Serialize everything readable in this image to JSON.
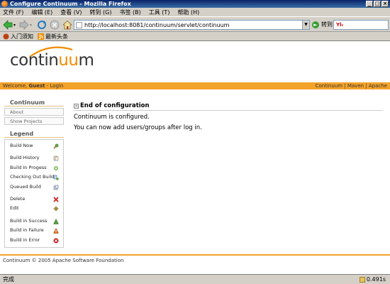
{
  "window": {
    "title": "Configure Continuum - Mozilla Firefox"
  },
  "menu": [
    "文件 (F)",
    "编辑 (E)",
    "查看 (V)",
    "转到 (G)",
    "书签 (B)",
    "工具 (T)",
    "帮助 (H)"
  ],
  "navbar": {
    "url": "http://localhost:8081/continuum/servlet/continuum",
    "go_label": "转到"
  },
  "bookmarks": [
    {
      "label": "入门须知",
      "icon": "firefox-bookmark-icon"
    },
    {
      "label": "最新头条",
      "icon": "rss-feed-icon"
    }
  ],
  "page": {
    "logo": {
      "pre": "contin",
      "accent": "uu",
      "post": "m"
    },
    "userbar": {
      "welcome": "Welcome,",
      "user": "Guest",
      "sep": " - ",
      "login": "Login",
      "links": [
        "Continuum",
        "Maven",
        "Apache"
      ]
    },
    "sidebar": {
      "title": "Continuum",
      "items": [
        "About",
        "Show Projects"
      ],
      "legend_title": "Legend",
      "legend": [
        {
          "label": "Build Now",
          "icon": "build-now-icon",
          "group": 1
        },
        {
          "label": "Build History",
          "icon": "build-history-icon",
          "group": 2
        },
        {
          "label": "Build In Progess",
          "icon": "build-in-progress-icon",
          "group": 2
        },
        {
          "label": "Checking Out Build",
          "icon": "checking-out-build-icon",
          "group": 2
        },
        {
          "label": "Queued Build",
          "icon": "queued-build-icon",
          "group": 2
        },
        {
          "label": "Delete",
          "icon": "delete-icon",
          "group": 3
        },
        {
          "label": "Edit",
          "icon": "edit-icon",
          "group": 3
        },
        {
          "label": "Build in Success",
          "icon": "build-success-icon",
          "group": 4
        },
        {
          "label": "Build in Failure",
          "icon": "build-failure-icon",
          "group": 4
        },
        {
          "label": "Build in Error",
          "icon": "build-error-icon",
          "group": 4
        }
      ]
    },
    "content": {
      "heading": "End of configuration",
      "message1": "Continuum is configured.",
      "message2": "You can now add users/groups after log in."
    },
    "footer": "Continuum © 2005 Apache Software Foundation"
  },
  "status": {
    "text": "完成",
    "timing": "0.491s"
  },
  "colors": {
    "accent": "#f3a22a",
    "logo_accent": "#f08c00"
  }
}
